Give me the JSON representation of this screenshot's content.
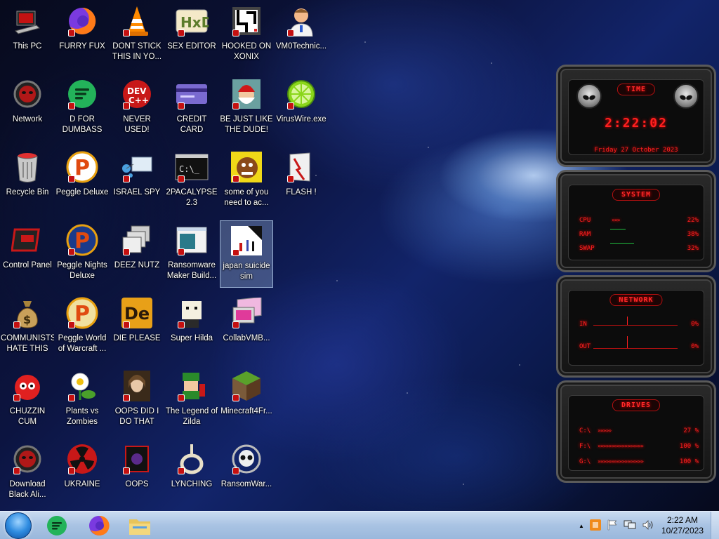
{
  "desktop": {
    "icons": [
      {
        "label": "This PC",
        "icon": "computer-icon"
      },
      {
        "label": "FURRY FUX",
        "icon": "firefox-icon"
      },
      {
        "label": "DONT STICK THIS IN YO...",
        "icon": "vlc-cone-icon"
      },
      {
        "label": "SEX EDITOR",
        "icon": "hxd-editor-icon"
      },
      {
        "label": "HOOKED ON XONIX",
        "icon": "xonix-game-icon"
      },
      {
        "label": "VM0Technic...",
        "icon": "doctor-icon"
      },
      {
        "label": "Network",
        "icon": "alien-orb-icon"
      },
      {
        "label": "D FOR DUMBASS",
        "icon": "discord-green-icon"
      },
      {
        "label": "NEVER USED!",
        "icon": "dev-cpp-icon"
      },
      {
        "label": "CREDIT CARD CHECKER",
        "icon": "credit-card-icon"
      },
      {
        "label": "BE JUST LIKE THE DUDE!",
        "icon": "santa-icon"
      },
      {
        "label": "VirusWire.exe",
        "icon": "lime-icon"
      },
      {
        "label": "Recycle Bin",
        "icon": "recycle-bin-icon"
      },
      {
        "label": "Peggle Deluxe",
        "icon": "peggle-icon"
      },
      {
        "label": "ISRAEL SPY",
        "icon": "network-monitor-icon"
      },
      {
        "label": "2PACALYPSE 2.3",
        "icon": "cmd-icon"
      },
      {
        "label": "some of you need to ac...",
        "icon": "dog-icon"
      },
      {
        "label": "FLASH !",
        "icon": "flash-icon"
      },
      {
        "label": "Control Panel",
        "icon": "control-panel-icon"
      },
      {
        "label": "Peggle Nights Deluxe",
        "icon": "peggle-nights-icon"
      },
      {
        "label": "DEEZ NUTZ",
        "icon": "stacked-windows-icon"
      },
      {
        "label": "Ransomware Maker Build...",
        "icon": "window-app-icon"
      },
      {
        "label": "japan suicide sim",
        "icon": "suicide-sim-icon"
      },
      {
        "label": "COMMUNISTS HATE THIS G...",
        "icon": "money-bag-icon"
      },
      {
        "label": "Peggle World of Warcraft ...",
        "icon": "peggle-wow-icon"
      },
      {
        "label": "DIE PLEASE",
        "icon": "de-icon"
      },
      {
        "label": "Super Hilda",
        "icon": "pixel-character-icon"
      },
      {
        "label": "CollabVMB...",
        "icon": "collabvm-icon"
      },
      {
        "label": "CHUZZIN CUM",
        "icon": "chuzzle-icon"
      },
      {
        "label": "Plants vs Zombies",
        "icon": "pvz-icon"
      },
      {
        "label": "OOPS DID I DO THAT",
        "icon": "portrait-icon"
      },
      {
        "label": "The Legend of Zilda",
        "icon": "zelda-icon"
      },
      {
        "label": "Minecraft4Fr...",
        "icon": "minecraft-icon"
      },
      {
        "label": "Download Black Ali...",
        "icon": "alien-orb-icon"
      },
      {
        "label": "UKRAINE",
        "icon": "radiation-icon"
      },
      {
        "label": "OOPS",
        "icon": "oops-box-icon"
      },
      {
        "label": "LYNCHING",
        "icon": "noose-icon"
      },
      {
        "label": "RansomWar...",
        "icon": "skull-icon"
      }
    ]
  },
  "widget": {
    "time": {
      "title": "TIME",
      "clock": "2:22:02",
      "date": "Friday 27 October 2023"
    },
    "system": {
      "title": "SYSTEM",
      "rows": [
        {
          "label": "CPU",
          "value": "22%"
        },
        {
          "label": "RAM",
          "value": "38%"
        },
        {
          "label": "SWAP",
          "value": "32%"
        }
      ],
      "levels": [
        0.22,
        0.38,
        0.32
      ]
    },
    "network": {
      "title": "NETWORK",
      "in_label": "IN",
      "in_value": "0%",
      "out_label": "OUT",
      "out_value": "0%"
    },
    "drives": {
      "title": "DRIVES",
      "rows": [
        {
          "label": "C:\\",
          "value": "27 %"
        },
        {
          "label": "F:\\",
          "value": "100 %"
        },
        {
          "label": "G:\\",
          "value": "100 %"
        }
      ]
    }
  },
  "taskbar": {
    "apps": [
      "discord-green-icon",
      "firefox-icon",
      "file-explorer-icon"
    ],
    "clock_time": "2:22 AM",
    "clock_date": "10/27/2023",
    "tray_chevron": "▲"
  }
}
